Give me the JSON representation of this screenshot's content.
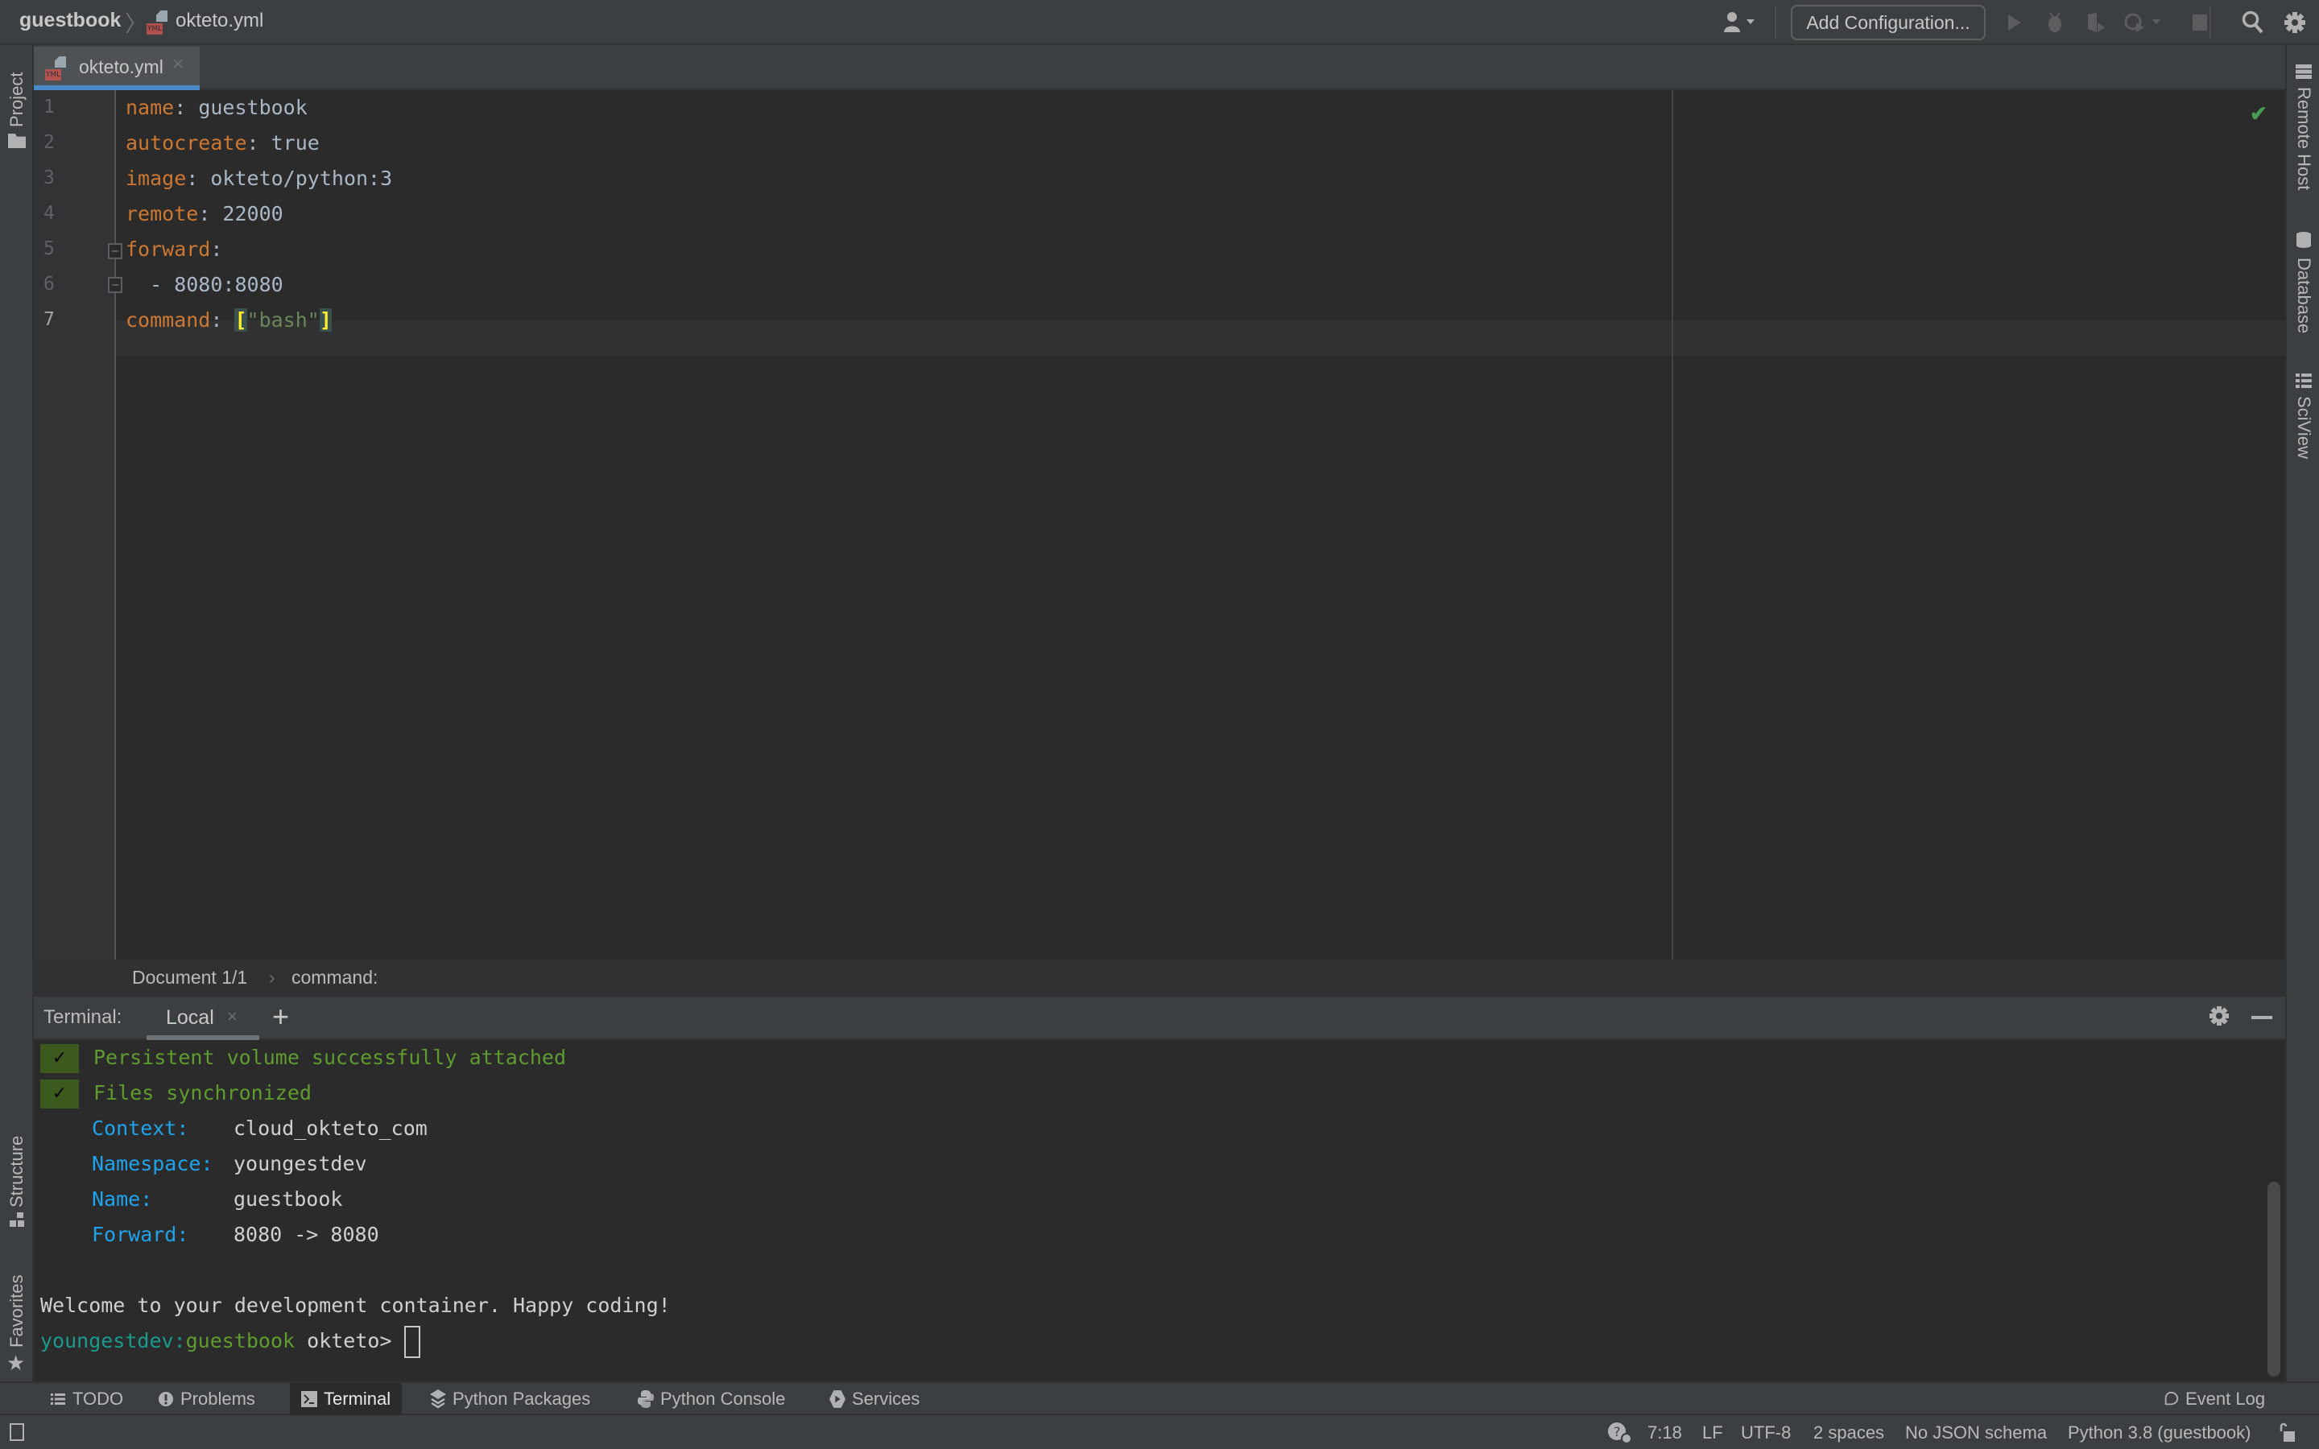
{
  "navbar": {
    "project": "guestbook",
    "file": "okteto.yml",
    "file_badge": "YML",
    "add_configuration": "Add Configuration..."
  },
  "left_strip": {
    "project": "Project",
    "structure": "Structure",
    "favorites": "Favorites"
  },
  "right_strip": {
    "remote_host": "Remote Host",
    "database": "Database",
    "sciview": "SciView"
  },
  "editor": {
    "tab_label": "okteto.yml",
    "tab_badge": "YML",
    "lines": [
      {
        "num": "1",
        "key": "name",
        "sep": ": ",
        "value": "guestbook"
      },
      {
        "num": "2",
        "key": "autocreate",
        "sep": ": ",
        "value": "true"
      },
      {
        "num": "3",
        "key": "image",
        "sep": ": ",
        "value": "okteto/python:3"
      },
      {
        "num": "4",
        "key": "remote",
        "sep": ": ",
        "value": "22000"
      },
      {
        "num": "5",
        "key": "forward",
        "sep": ":",
        "value": ""
      },
      {
        "num": "6",
        "key": "",
        "sep": "",
        "value": "  - 8080:8080"
      },
      {
        "num": "7",
        "key": "command",
        "sep": ": ",
        "value": "",
        "open": "[",
        "string": "\"bash\"",
        "close": "]"
      }
    ],
    "current_line": 7
  },
  "breadcrumb": {
    "doc": "Document 1/1",
    "sep": "›",
    "node": "command:"
  },
  "terminal": {
    "title": "Terminal:",
    "tab": "Local",
    "add": "+",
    "check_glyph": "✓",
    "success": [
      "Persistent volume successfully attached",
      "Files synchronized"
    ],
    "info": [
      {
        "key": "Context:",
        "value": "cloud_okteto_com"
      },
      {
        "key": "Namespace:",
        "value": "youngestdev"
      },
      {
        "key": "Name:",
        "value": "guestbook"
      },
      {
        "key": "Forward:",
        "value": "8080 -> 8080"
      }
    ],
    "welcome": "Welcome to your development container. Happy coding!",
    "prompt_ns": "youngestdev:",
    "prompt_name": "guestbook",
    "prompt_cmd": " okteto> "
  },
  "tool_windows": [
    {
      "label": "TODO",
      "icon": "list-icon"
    },
    {
      "label": "Problems",
      "icon": "warning-icon"
    },
    {
      "label": "Terminal",
      "icon": "terminal-icon",
      "active": true
    },
    {
      "label": "Python Packages",
      "icon": "layers-icon"
    },
    {
      "label": "Python Console",
      "icon": "python-icon"
    },
    {
      "label": "Services",
      "icon": "services-icon"
    }
  ],
  "event_log": "Event Log",
  "status": {
    "position": "7:18",
    "line_sep": "LF",
    "encoding": "UTF-8",
    "indent": "2 spaces",
    "schema": "No JSON schema",
    "interpreter": "Python 3.8 (guestbook)"
  },
  "colors": {
    "accent": "#4a88c7",
    "yaml_key": "#cc7832",
    "string": "#6a8759",
    "success": "#5e9c2f",
    "term_key": "#1fa3ec",
    "inspection_ok": "#499c54"
  }
}
